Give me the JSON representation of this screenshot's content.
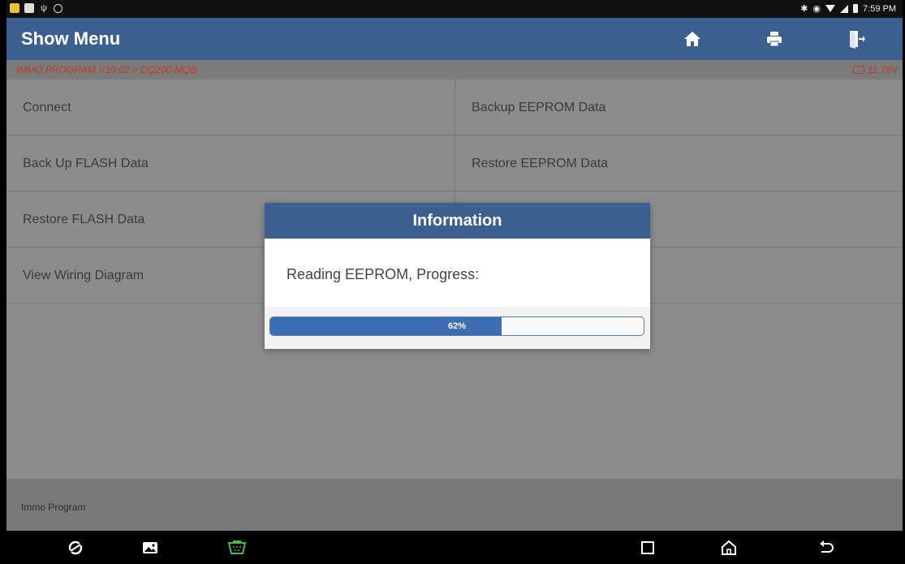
{
  "status_bar": {
    "time": "7:59 PM",
    "icons": [
      "notification-icon",
      "image-icon",
      "usb-icon",
      "settings-icon",
      "bluetooth-icon",
      "location-icon",
      "wifi-icon",
      "signal-icon",
      "battery-icon"
    ]
  },
  "header": {
    "title": "Show Menu",
    "icons": [
      "home-icon",
      "print-icon",
      "exit-icon"
    ]
  },
  "breadcrumb": {
    "path": "IMMO PROGRAM V10.02 > DQ200-MQB",
    "voltage": "11.78V"
  },
  "menu": {
    "left": [
      "Connect",
      "Back Up FLASH Data",
      "Restore FLASH Data",
      "View Wiring Diagram"
    ],
    "right": [
      "Backup EEPROM Data",
      "Restore EEPROM Data"
    ]
  },
  "footer": {
    "label": "Immo Program"
  },
  "dialog": {
    "title": "Information",
    "message": "Reading EEPROM, Progress:",
    "progress_percent": 62,
    "progress_label": "62%"
  },
  "colors": {
    "header_bg": "#3b5f8f",
    "progress_fill": "#3d6db3",
    "breadcrumb_text": "#c0392b"
  },
  "nav_bar": {
    "icons": [
      "browser-icon",
      "gallery-icon",
      "obd-connector-icon",
      "recents-icon",
      "home-icon",
      "back-icon"
    ]
  }
}
